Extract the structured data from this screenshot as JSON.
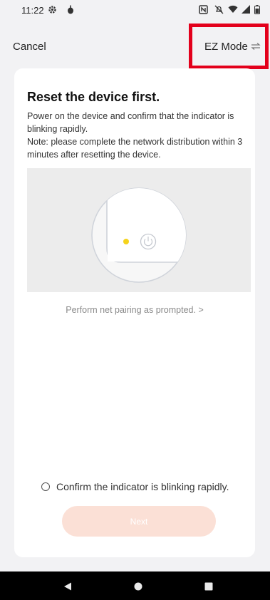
{
  "status_bar": {
    "time": "11:22",
    "icons": [
      "settings-icon",
      "notification-icon",
      "nfc-icon",
      "mute-icon",
      "wifi-icon",
      "signal-icon",
      "battery-icon"
    ]
  },
  "top_nav": {
    "cancel_label": "Cancel",
    "mode_label": "EZ Mode",
    "mode_icon": "switch-arrows-icon"
  },
  "card": {
    "title": "Reset the device first.",
    "desc_line1": "Power on the device and confirm that the indicator is blinking rapidly.",
    "desc_line2": "Note: please complete the network distribution within 3 minutes after resetting the device.",
    "pair_link": "Perform net pairing as prompted. >",
    "confirm_label": "Confirm the indicator is blinking rapidly.",
    "next_label": "Next"
  },
  "colors": {
    "highlight": "#e3001b",
    "indicator": "#f5d31b",
    "next_button": "#fbe0d6",
    "background": "#f2f2f4"
  },
  "nav_bar": {
    "icons": [
      "back-icon",
      "home-icon",
      "recents-icon"
    ]
  }
}
